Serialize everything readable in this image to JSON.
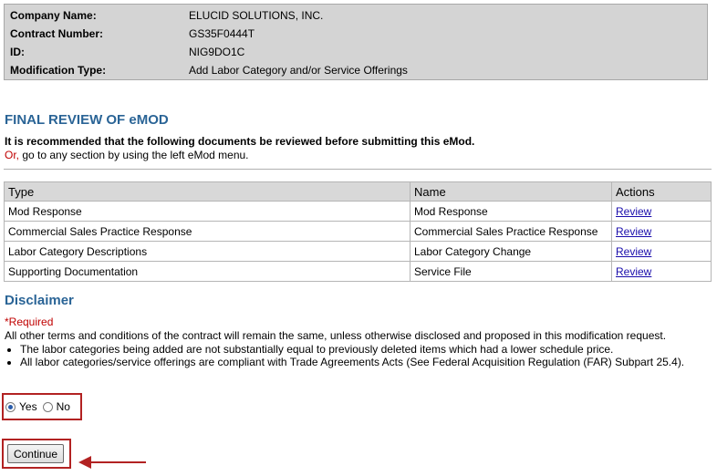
{
  "info": {
    "rows": [
      {
        "label": "Company Name:",
        "value": "ELUCID SOLUTIONS, INC."
      },
      {
        "label": "Contract Number:",
        "value": "GS35F0444T"
      },
      {
        "label": "ID:",
        "value": "NIG9DO1C"
      },
      {
        "label": "Modification Type:",
        "value": "Add Labor Category and/or Service Offerings"
      }
    ]
  },
  "final_review": {
    "title": "FINAL REVIEW OF eMOD",
    "recommend_text": "It is recommended that the following documents be reviewed before submitting this eMod.",
    "or_word": "Or,",
    "or_rest": " go to any section by using the left eMod menu."
  },
  "table": {
    "headers": [
      "Type",
      "Name",
      "Actions"
    ],
    "rows": [
      {
        "type": "Mod Response",
        "name": "Mod Response",
        "action": "Review"
      },
      {
        "type": "Commercial Sales Practice Response",
        "name": "Commercial Sales Practice Response",
        "action": "Review"
      },
      {
        "type": "Labor Category Descriptions",
        "name": "Labor Category Change",
        "action": "Review"
      },
      {
        "type": "Supporting Documentation",
        "name": "Service File",
        "action": "Review"
      }
    ]
  },
  "disclaimer": {
    "title": "Disclaimer",
    "required": "*Required",
    "terms": "All other terms and conditions of the contract will remain the same, unless otherwise disclosed and proposed in this modification request.",
    "bullets": [
      "The labor categories being added are not substantially equal to previously deleted items which had a lower schedule price.",
      "All labor categories/service offerings are compliant with Trade Agreements Acts (See Federal Acquisition Regulation (FAR) Subpart 25.4)."
    ],
    "yes_label": "Yes",
    "no_label": "No",
    "selected": "Yes"
  },
  "actions": {
    "continue_label": "Continue"
  },
  "colors": {
    "accent_title": "#2a6496",
    "required_red": "#c00000",
    "highlight_border": "#b22222",
    "arrow": "#b22222"
  }
}
